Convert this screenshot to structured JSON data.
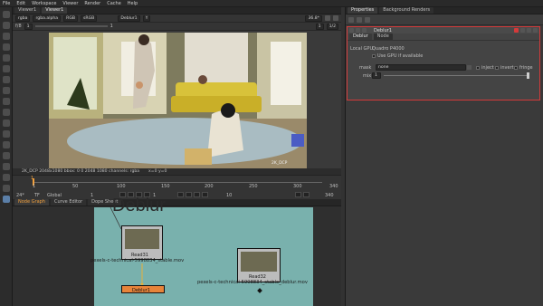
{
  "menu": [
    "File",
    "Edit",
    "Workspace",
    "Viewer",
    "Render",
    "Cache",
    "Help"
  ],
  "viewer": {
    "tabs": [
      "Viewer1",
      "Viewer1"
    ],
    "controls": [
      "rgba",
      "rgba.alpha",
      "RGB",
      "sRGB"
    ],
    "deblur_chip": "Deblur1",
    "exposure": "1",
    "zoom": "36.8*",
    "input_chip": "Y",
    "compare": "1",
    "gain": "f/8",
    "gamma": "1",
    "frame": "1",
    "frame_right": "1/2",
    "corner_label": "2K_DCP",
    "info": "2K_DCP 2048x1080  bbox: 0 0 2048 1080 channels: rgba",
    "coords": "x=0 y=0"
  },
  "timeline": {
    "fps": "24*",
    "tf": "TF",
    "global": "Global",
    "start": "1",
    "end": "340",
    "ticks": [
      "1",
      "50",
      "100",
      "150",
      "200",
      "250",
      "300"
    ],
    "step": "10",
    "playhead_frame": "1",
    "skip": "10"
  },
  "node_graph": {
    "tabs": [
      "Node Graph",
      "Curve Editor",
      "Dope Sheet"
    ],
    "big_title": "Deblur",
    "nodes": [
      {
        "label": "Read31",
        "file": "pexels-c-technical-5998834_stable.mov"
      },
      {
        "label": "Read32",
        "file": "pexels-c-technical-5998834_stable_deblur.mov"
      }
    ],
    "deblur_node": "Deblur1"
  },
  "properties": {
    "tabs": [
      "Properties",
      "Background Renders"
    ],
    "node_name": "Deblur1",
    "subtabs": [
      "Deblur",
      "Node"
    ],
    "local_gpu_label": "Local GPU:",
    "local_gpu_value": "Quadro P4000",
    "use_gpu": "Use GPU if available",
    "mask_label": "mask",
    "mask_value": "none",
    "inject": "inject",
    "invert": "invert",
    "fringe": "fringe",
    "mix_label": "mix",
    "mix_value": "1"
  },
  "colors": {
    "accent_orange": "#f2a03d",
    "highlight_red": "#d43a3a",
    "graph_bg": "#79b1ad",
    "deblur_node": "#e8843a"
  }
}
